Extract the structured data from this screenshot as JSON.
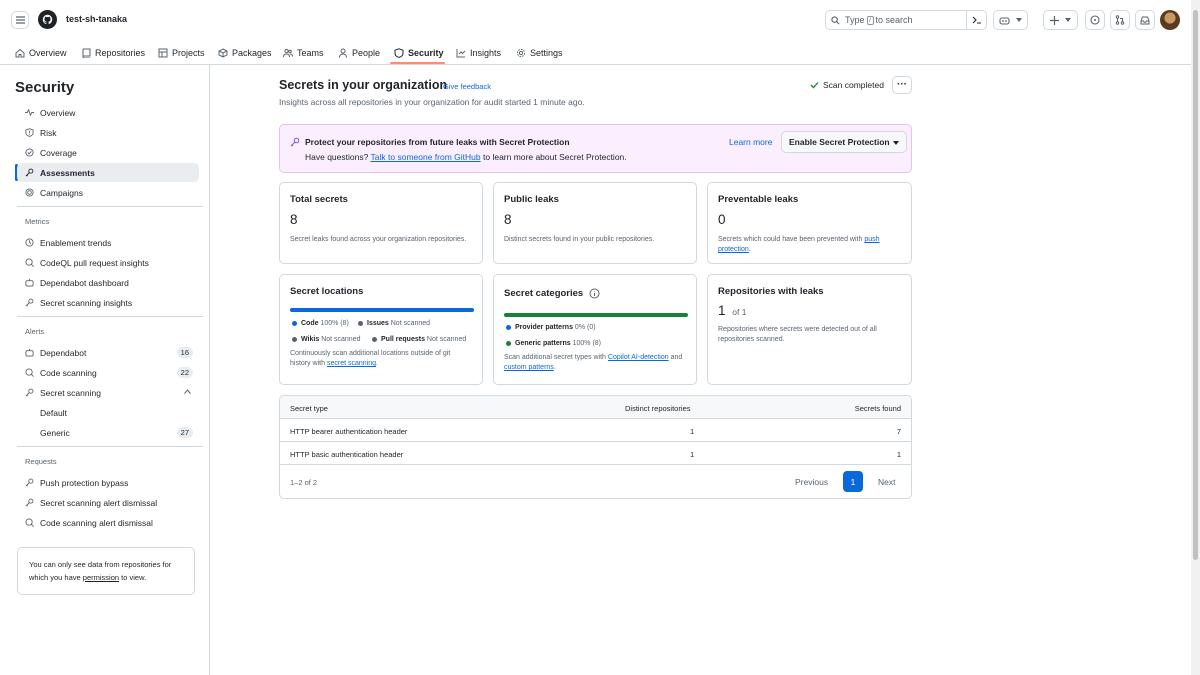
{
  "header": {
    "org_name": "test-sh-tanaka",
    "search_prefix": "Type",
    "search_key": "/",
    "search_suffix": "to search",
    "icons": [
      "hamburger-icon",
      "github-logo",
      "search-icon",
      "command-palette-icon",
      "copilot-icon",
      "plus-icon",
      "issues-icon",
      "pull-requests-icon",
      "inbox-icon",
      "avatar"
    ]
  },
  "tabs": [
    {
      "label": "Overview",
      "icon": "home-icon"
    },
    {
      "label": "Repositories",
      "icon": "repo-icon"
    },
    {
      "label": "Projects",
      "icon": "table-icon"
    },
    {
      "label": "Packages",
      "icon": "package-icon"
    },
    {
      "label": "Teams",
      "icon": "people-icon"
    },
    {
      "label": "People",
      "icon": "person-icon"
    },
    {
      "label": "Security",
      "icon": "shield-icon",
      "active": true
    },
    {
      "label": "Insights",
      "icon": "graph-icon"
    },
    {
      "label": "Settings",
      "icon": "gear-icon"
    }
  ],
  "sidebar": {
    "title": "Security",
    "items": [
      {
        "label": "Overview",
        "icon": "pulse-icon"
      },
      {
        "label": "Risk",
        "icon": "shield-icon"
      },
      {
        "label": "Coverage",
        "icon": "coverage-icon"
      },
      {
        "label": "Assessments",
        "icon": "key-icon",
        "active": true
      },
      {
        "label": "Campaigns",
        "icon": "campaign-icon"
      }
    ],
    "metrics_heading": "Metrics",
    "metrics": [
      {
        "label": "Enablement trends",
        "icon": "clock-icon"
      },
      {
        "label": "CodeQL pull request insights",
        "icon": "codescan-icon"
      },
      {
        "label": "Dependabot dashboard",
        "icon": "dependabot-icon"
      },
      {
        "label": "Secret scanning insights",
        "icon": "key-icon"
      }
    ],
    "alerts_heading": "Alerts",
    "alerts": [
      {
        "label": "Dependabot",
        "icon": "dependabot-icon",
        "count": "16"
      },
      {
        "label": "Code scanning",
        "icon": "codescan-icon",
        "count": "22"
      },
      {
        "label": "Secret scanning",
        "icon": "key-icon",
        "count": ""
      },
      {
        "label": "Default",
        "count": ""
      },
      {
        "label": "Generic",
        "count": "27"
      }
    ],
    "requests_heading": "Requests",
    "requests": [
      {
        "label": "Push protection bypass",
        "icon": "key-icon"
      },
      {
        "label": "Secret scanning alert dismissal",
        "icon": "key-icon"
      },
      {
        "label": "Code scanning alert dismissal",
        "icon": "codescan-icon"
      }
    ],
    "note_prefix": "You can only see data from repositories for which you have",
    "note_link": "permission",
    "note_suffix": "to view."
  },
  "main": {
    "title": "Secrets in your organization",
    "feedback": "Give feedback",
    "subtitle": "Insights across all repositories in your organization for audit started 1 minute ago.",
    "scan_status": "Scan completed",
    "more_label": "···"
  },
  "banner": {
    "title": "Protect your repositories from future leaks with Secret Protection",
    "sub_prefix": "Have questions?",
    "sub_link": "Talk to someone from GitHub",
    "sub_suffix": "to learn more about Secret Protection.",
    "learn_more": "Learn more",
    "enable_button": "Enable Secret Protection"
  },
  "cards": {
    "total": {
      "title": "Total secrets",
      "value": "8",
      "desc": "Secret leaks found across your organization repositories."
    },
    "public": {
      "title": "Public leaks",
      "value": "8",
      "desc": "Distinct secrets found in your public repositories."
    },
    "preventable": {
      "title": "Preventable leaks",
      "value": "0",
      "desc_prefix": "Secrets which could have been prevented with",
      "desc_link": "push protection",
      "desc_suffix": "."
    },
    "locations": {
      "title": "Secret locations",
      "bar_color": "#0969da",
      "code_label": "Code",
      "code_value": "100% (8)",
      "issues_label": "Issues",
      "issues_value": "Not scanned",
      "wikis_label": "Wikis",
      "wikis_value": "Not scanned",
      "prs_label": "Pull requests",
      "prs_value": "Not scanned",
      "desc_prefix": "Continuously scan additional locations outside of git history with",
      "desc_link": "secret scanning",
      "desc_suffix": "."
    },
    "categories": {
      "title": "Secret categories",
      "bar_color": "#1a7f37",
      "provider_label": "Provider patterns",
      "provider_value": "0% (0)",
      "generic_label": "Generic patterns",
      "generic_value": "100% (8)",
      "desc_prefix": "Scan additional secret types with",
      "desc_link1": "Copilot AI-detection",
      "desc_mid": "and",
      "desc_link2": "custom patterns",
      "desc_suffix": "."
    },
    "repos": {
      "title": "Repositories with leaks",
      "value": "1",
      "of": "of 1",
      "desc": "Repositories where secrets were detected out of all repositories scanned."
    }
  },
  "table": {
    "headers": [
      "Secret type",
      "Distinct repositories",
      "Secrets found"
    ],
    "rows": [
      [
        "HTTP bearer authentication header",
        "1",
        "7"
      ],
      [
        "HTTP basic authentication header",
        "1",
        "1"
      ]
    ],
    "range": "1–2 of 2",
    "prev": "Previous",
    "current_page": "1",
    "next": "Next"
  }
}
